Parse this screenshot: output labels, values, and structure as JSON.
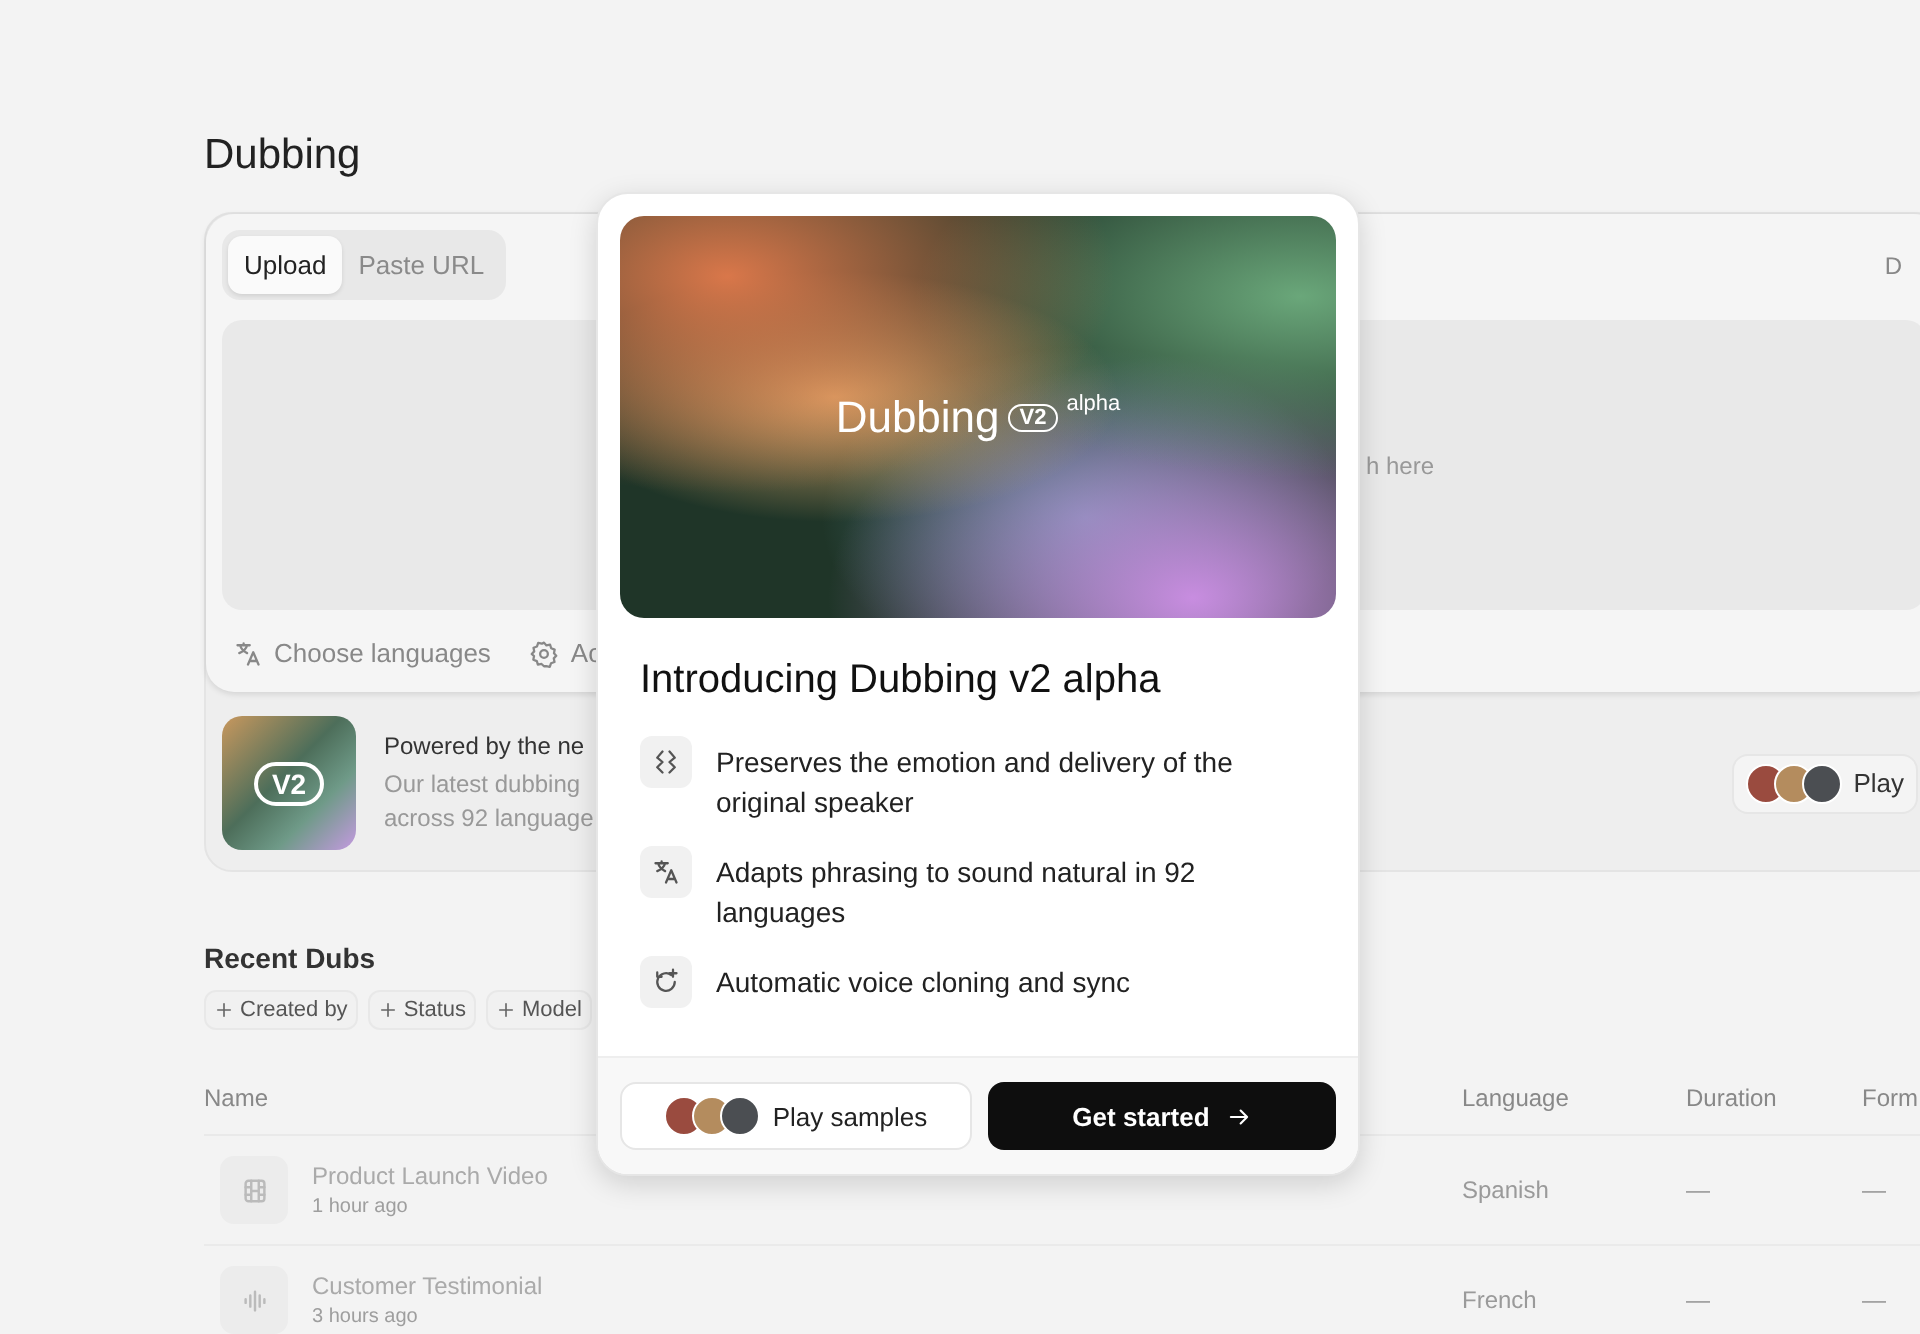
{
  "page_title": "Dubbing",
  "upload_card": {
    "tabs": [
      {
        "label": "Upload",
        "selected": true
      },
      {
        "label": "Paste URL",
        "selected": false
      }
    ],
    "corner_text": "D",
    "drop_hint": "h here",
    "options": [
      {
        "label": "Choose languages"
      },
      {
        "label": "Ac"
      }
    ]
  },
  "promo": {
    "badge": "V2",
    "title": "Powered by the ne",
    "description_lines": [
      "Our latest dubbing",
      "across 92 language"
    ],
    "play_button": "Play"
  },
  "recent": {
    "title": "Recent Dubs",
    "filters": [
      "Created by",
      "Status",
      "Model"
    ],
    "columns": [
      "Name",
      "Language",
      "Duration",
      "Form"
    ],
    "rows": [
      {
        "name": "Product Launch Video",
        "time": "1 hour ago",
        "language": "Spanish",
        "duration": "—",
        "format": "—"
      },
      {
        "name": "Customer Testimonial",
        "time": "3 hours ago",
        "language": "French",
        "duration": "—",
        "format": "—"
      }
    ]
  },
  "modal": {
    "banner": {
      "title": "Dubbing",
      "badge": "V2",
      "tag": "alpha"
    },
    "heading": "Introducing Dubbing v2 alpha",
    "features": [
      {
        "text": "Preserves the emotion and delivery of the original speaker"
      },
      {
        "text": "Adapts phrasing to sound natural in 92 languages"
      },
      {
        "text": "Automatic voice cloning and sync"
      }
    ],
    "secondary_button": "Play samples",
    "primary_button": "Get started"
  }
}
